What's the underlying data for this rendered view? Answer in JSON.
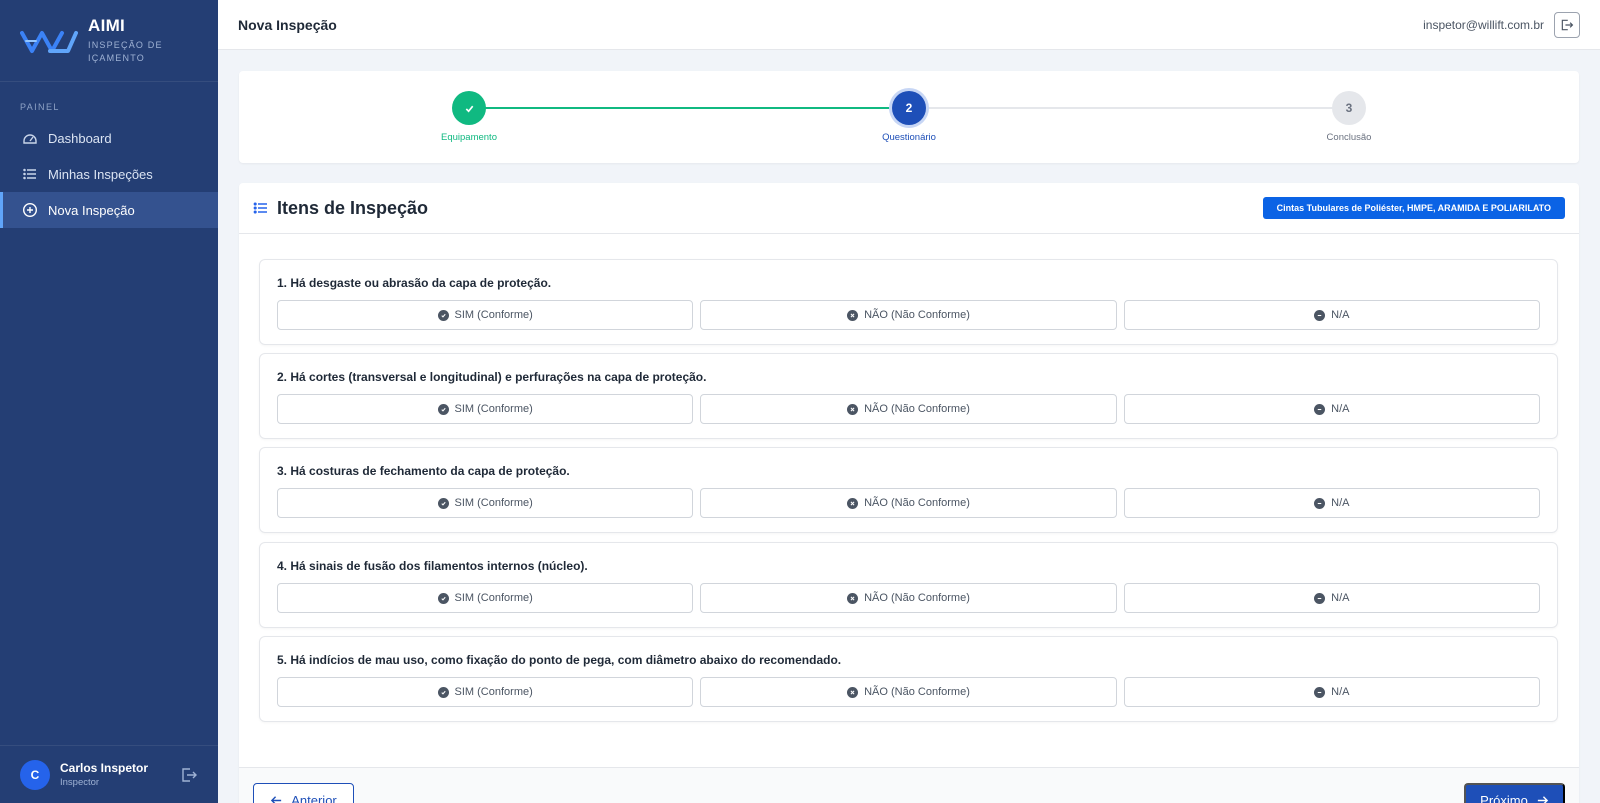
{
  "brand": {
    "name": "AIMI",
    "subtitle": "INSPEÇÃO DE IÇAMENTO"
  },
  "sidebar": {
    "section_label": "PAINEL",
    "items": [
      {
        "label": "Dashboard",
        "icon": "dashboard-icon"
      },
      {
        "label": "Minhas Inspeções",
        "icon": "list-icon"
      },
      {
        "label": "Nova Inspeção",
        "icon": "plus-circle-icon",
        "active": true
      }
    ],
    "user": {
      "initial": "C",
      "name": "Carlos Inspetor",
      "role": "Inspector"
    }
  },
  "header": {
    "title": "Nova Inspeção",
    "email": "inspetor@willift.com.br"
  },
  "stepper": {
    "steps": [
      {
        "label": "Equipamento",
        "number": "",
        "state": "done"
      },
      {
        "label": "Questionário",
        "number": "2",
        "state": "current"
      },
      {
        "label": "Conclusão",
        "number": "3",
        "state": "pending"
      }
    ]
  },
  "inspection": {
    "title": "Itens de Inspeção",
    "category": "Cintas Tubulares de Poliéster, HMPE, ARAMIDA E POLIARILATO",
    "options": {
      "yes": "SIM (Conforme)",
      "no": "NÃO (Não Conforme)",
      "na": "N/A"
    },
    "questions": [
      "1. Há desgaste ou abrasão da capa de proteção.",
      "2. Há cortes (transversal e longitudinal) e perfurações na capa de proteção.",
      "3. Há costuras de fechamento da capa de proteção.",
      "4. Há sinais de fusão dos filamentos internos (núcleo).",
      "5. Há indícios de mau uso, como fixação do ponto de pega, com diâmetro abaixo do recomendado."
    ]
  },
  "footer": {
    "prev_label": "Anterior",
    "next_label": "Próximo"
  },
  "colors": {
    "sidebar": "#243e74",
    "primary": "#1e4fb8",
    "success": "#10b981",
    "badge": "#0b63e5"
  }
}
